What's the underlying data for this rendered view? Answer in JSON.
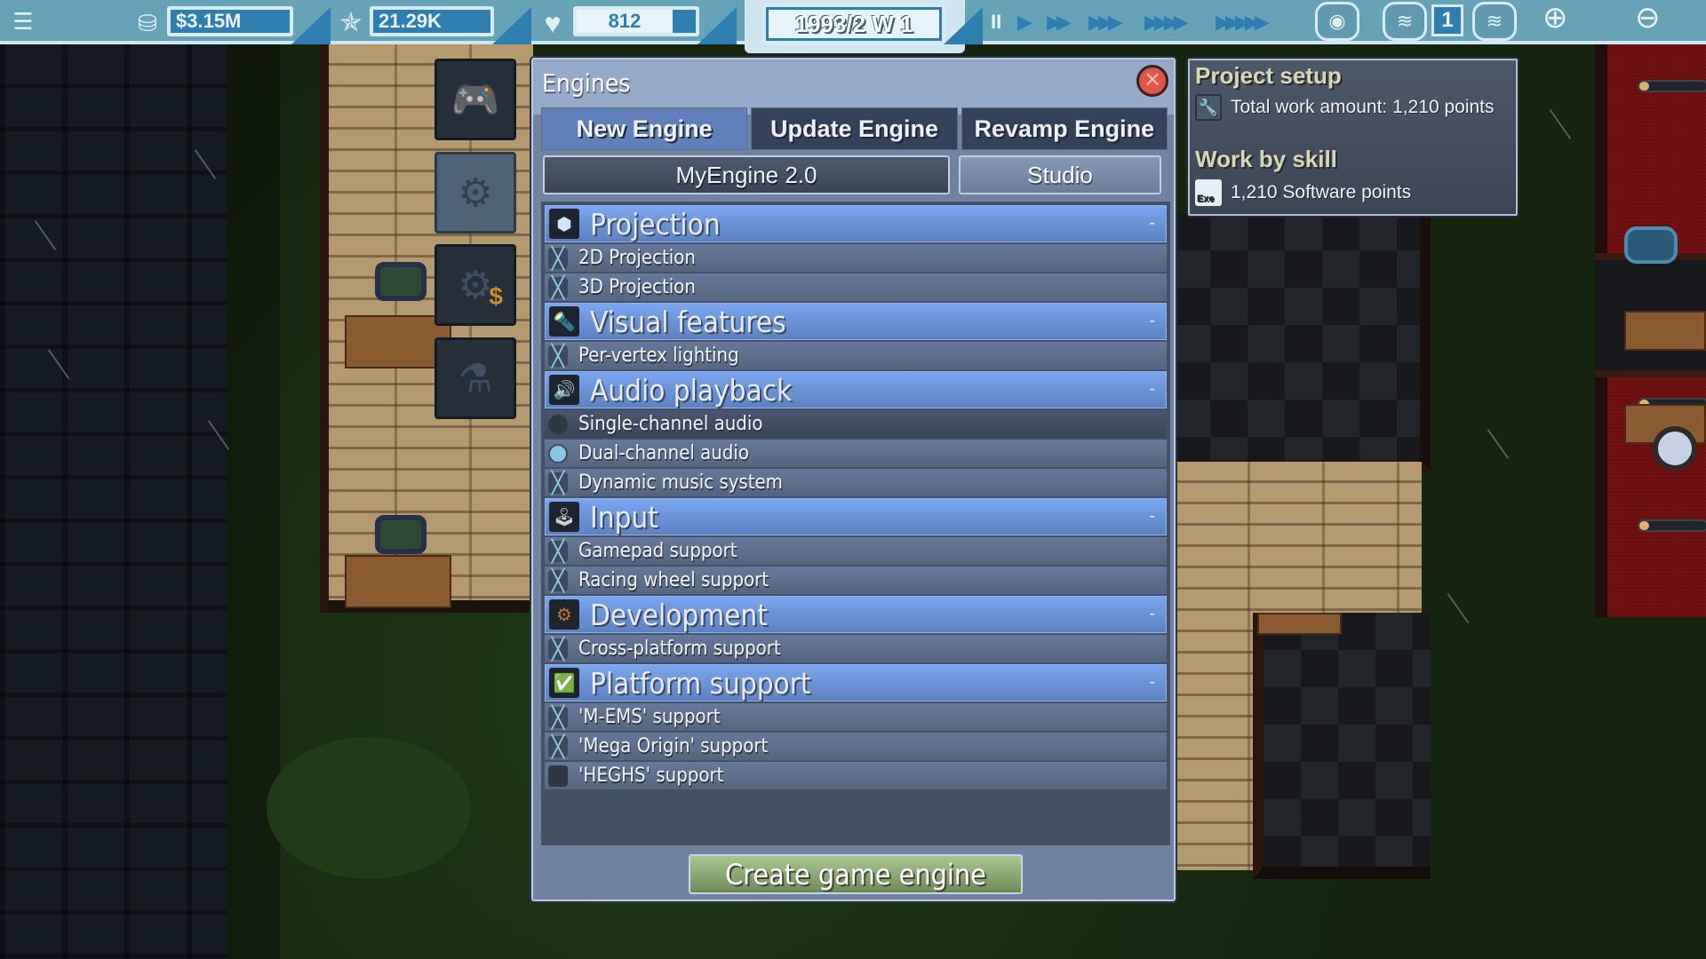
{
  "topbar": {
    "menu_icon": "menu-list-icon",
    "money": {
      "icon": "coins-icon",
      "value": "$3.15M"
    },
    "reputation": {
      "icon": "star-icon",
      "value": "21.29K"
    },
    "fans": {
      "icon": "heart-icon",
      "value": "812"
    },
    "date": "1993/2 W 1",
    "speed_controls": [
      {
        "name": "pause",
        "glyph": "II"
      },
      {
        "name": "speed-1",
        "glyph": "▶"
      },
      {
        "name": "speed-2",
        "glyph": "▶▶"
      },
      {
        "name": "speed-3",
        "glyph": "▶▶▶"
      },
      {
        "name": "speed-4",
        "glyph": "▶▶▶▶"
      },
      {
        "name": "speed-5",
        "glyph": "▶▶▶▶▶"
      }
    ],
    "camera_icon": "webcam-icon",
    "floor_down_icon": "layers-down-icon",
    "floor_number": "1",
    "floor_up_icon": "layers-up-icon",
    "zoom_in_icon": "zoom-in-icon",
    "zoom_out_icon": "zoom-out-icon"
  },
  "side_tabs": [
    {
      "name": "console",
      "icon": "gamepad-icon",
      "active": false
    },
    {
      "name": "engines",
      "icon": "gears-icon",
      "active": true
    },
    {
      "name": "engine-licensing",
      "icon": "gears-dollar-icon",
      "active": false
    },
    {
      "name": "research",
      "icon": "flask-icon",
      "active": false
    }
  ],
  "dialog": {
    "title": "Engines",
    "close_icon": "close-x-icon",
    "tabs": [
      {
        "label": "New Engine",
        "active": true
      },
      {
        "label": "Update Engine",
        "active": false
      },
      {
        "label": "Revamp Engine",
        "active": false
      }
    ],
    "engine_name": "MyEngine 2.0",
    "studio_button": "Studio",
    "categories": [
      {
        "label": "Projection",
        "icon": "projection-cube-icon",
        "collapse": "-",
        "items": [
          {
            "label": "2D Projection",
            "state": "checked"
          },
          {
            "label": "3D Projection",
            "state": "checked"
          }
        ]
      },
      {
        "label": "Visual features",
        "icon": "spotlight-icon",
        "collapse": "-",
        "items": [
          {
            "label": "Per-vertex lighting",
            "state": "checked"
          }
        ]
      },
      {
        "label": "Audio playback",
        "icon": "speaker-music-icon",
        "collapse": "-",
        "items": [
          {
            "label": "Single-channel audio",
            "state": "radio-off"
          },
          {
            "label": "Dual-channel audio",
            "state": "radio-on"
          },
          {
            "label": "Dynamic music system",
            "state": "checked"
          }
        ]
      },
      {
        "label": "Input",
        "icon": "joystick-icon",
        "collapse": "-",
        "items": [
          {
            "label": "Gamepad support",
            "state": "checked"
          },
          {
            "label": "Racing wheel support",
            "state": "checked"
          }
        ]
      },
      {
        "label": "Development",
        "icon": "dev-gears-icon",
        "collapse": "-",
        "items": [
          {
            "label": "Cross-platform support",
            "state": "checked"
          }
        ]
      },
      {
        "label": "Platform support",
        "icon": "platform-check-icon",
        "collapse": "-",
        "items": [
          {
            "label": "'M-EMS' support",
            "state": "checked"
          },
          {
            "label": "'Mega Origin' support",
            "state": "checked"
          },
          {
            "label": "'HEGHS' support",
            "state": "unchecked"
          }
        ]
      }
    ],
    "create_button": "Create game engine"
  },
  "project_setup": {
    "title": "Project setup",
    "total_work": "Total work amount: 1,210 points",
    "work_by_skill_title": "Work by skill",
    "software_points": "1,210 Software points"
  },
  "scene": {
    "employee_progress": [
      0.15,
      0.15,
      0.15
    ]
  }
}
